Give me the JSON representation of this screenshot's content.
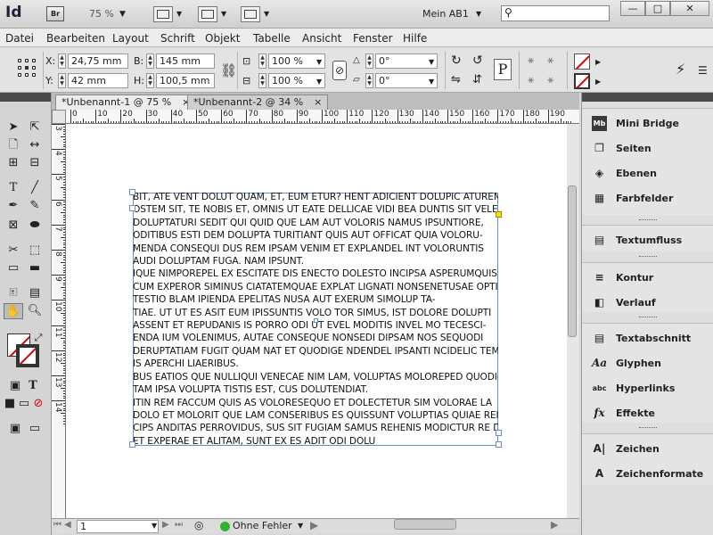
{
  "app": {
    "logo": "Id",
    "bridge_label": "Br",
    "zoom": "75 %",
    "workspace": "Mein AB1",
    "search_placeholder": "",
    "window_buttons": [
      "—",
      "□",
      "✕"
    ]
  },
  "menu": [
    "Datei",
    "Bearbeiten",
    "Layout",
    "Schrift",
    "Objekt",
    "Tabelle",
    "Ansicht",
    "Fenster",
    "Hilfe"
  ],
  "control": {
    "x_label": "X:",
    "x_value": "24,75 mm",
    "y_label": "Y:",
    "y_value": "42 mm",
    "b_label": "B:",
    "b_value": "145 mm",
    "h_label": "H:",
    "h_value": "100,5 mm",
    "scale_x": "100 %",
    "scale_y": "100 %",
    "rotate": "0°",
    "shear": "0°"
  },
  "tabs": [
    {
      "label": "*Unbenannt-1 @ 75 %",
      "close": "×"
    },
    {
      "label": "*Unbenannt-2 @ 34 %",
      "close": "×"
    }
  ],
  "ruler": {
    "h_ticks": [
      "0",
      "10",
      "20",
      "30",
      "40",
      "50",
      "60",
      "70",
      "80",
      "90",
      "100",
      "110",
      "120",
      "130",
      "140",
      "150",
      "160",
      "170",
      "180",
      "190"
    ],
    "v_ticks": [
      "3",
      "4",
      "5",
      "6",
      "7",
      "8",
      "9",
      "10",
      "11",
      "12",
      "13",
      "14"
    ]
  },
  "frame_text": [
    "BIT, ATE VENT DOLUT QUAM, ET, EUM ETUR? HENT ADICIENT DOLUPIC ATUREM.",
    "OSTEM SIT, TE NOBIS ET, OMNIS UT EATE DELLICAE VIDI BEA DUNTIS SIT VELENIS",
    "DOLUPTATURI SEDIT QUI QUID QUE LAM AUT VOLORIS NAMUS IPSUNTIORE,",
    "ODITIBUS ESTI DEM DOLUPTA TURITIANT QUIS AUT OFFICAT QUIA VOLORU-",
    "MENDA CONSEQUI DUS REM IPSAM VENIM ET EXPLANDEL INT VOLORUNTIS",
    "AUDI DOLUPTAM FUGA. NAM IPSUNT.",
    "IQUE NIMPOREPEL EX ESCITATE DIS ENECTO DOLESTO INCIPSA ASPERUMQUIS",
    "CUM EXPEROR SIMINUS CIATATEMQUAE EXPLAT LIGNATI NONSENETUSAE OPTI",
    "TESTIO BLAM IPIENDA EPELITAS NUSA AUT EXERUM SIMOLUP TA-",
    "TIAE. UT UT ES ASIT EUM IPISSUNTIS VOLO TOR SIMUS, IST DOLORE DOLUPTI",
    "ASSENT ET REPUDANIS IS PORRO ODI UT EVEL MODITIS INVEL MO TECESCI-",
    "ENDA IUM VOLENIMUS, AUTAE CONSEQUE NONSEDI DIPSAM NOS SEQUODI",
    "DERUPTATIAM FUGIT QUAM NAT ET QUODIGE NDENDEL IPSANTI NCIDELIC TEM",
    "IS APERCHI LIAERIBUS.",
    "BUS EATIOS QUE NULLIQUI VENECAE NIM LAM, VOLUPTAS MOLOREPED QUODI-",
    "TAM IPSA VOLUPTA TISTIS EST, CUS DOLUTENDIAT.",
    "ITIN REM FACCUM QUIS AS VOLORESEQUO ET DOLECTETUR SIM VOLORAE LA",
    "DOLO ET MOLORIT QUE LAM CONSERIBUS ES QUISSUNT VOLUPTIAS QUIAE REI-",
    "CIPS ANDITAS PERROVIDUS, SUS SIT FUGIAM SAMUS REHENIS MODICTUR RE DE",
    "ET EXPERAE ET ALITAM, SUNT EX ES ADIT ODI DOLU"
  ],
  "status": {
    "page": "1",
    "errors": "Ohne Fehler"
  },
  "panels": {
    "group1": [
      {
        "label": "Mini Bridge",
        "icon": "mini-bridge-icon",
        "glyph": "Mb"
      },
      {
        "label": "Seiten",
        "icon": "pages-icon",
        "glyph": "❐"
      },
      {
        "label": "Ebenen",
        "icon": "layers-icon",
        "glyph": "◈"
      },
      {
        "label": "Farbfelder",
        "icon": "swatches-icon",
        "glyph": "▦"
      }
    ],
    "group2": [
      {
        "label": "Textumfluss",
        "icon": "text-wrap-icon",
        "glyph": "▤"
      }
    ],
    "group3": [
      {
        "label": "Kontur",
        "icon": "stroke-icon",
        "glyph": "≡"
      },
      {
        "label": "Verlauf",
        "icon": "gradient-icon",
        "glyph": "◧"
      }
    ],
    "group4": [
      {
        "label": "Textabschnitt",
        "icon": "story-icon",
        "glyph": "▤"
      },
      {
        "label": "Glyphen",
        "icon": "glyphs-icon",
        "glyph": "Aa"
      },
      {
        "label": "Hyperlinks",
        "icon": "hyperlinks-icon",
        "glyph": "abc"
      },
      {
        "label": "Effekte",
        "icon": "effects-icon",
        "glyph": "fx"
      }
    ],
    "group5": [
      {
        "label": "Zeichen",
        "icon": "character-icon",
        "glyph": "A|"
      },
      {
        "label": "Zeichenformate",
        "icon": "character-styles-icon",
        "glyph": "A"
      }
    ]
  },
  "colors": {
    "frame_border": "#6a8fc8",
    "status_ok": "#2cb52c",
    "panel_dark": "#4a4a4a"
  }
}
